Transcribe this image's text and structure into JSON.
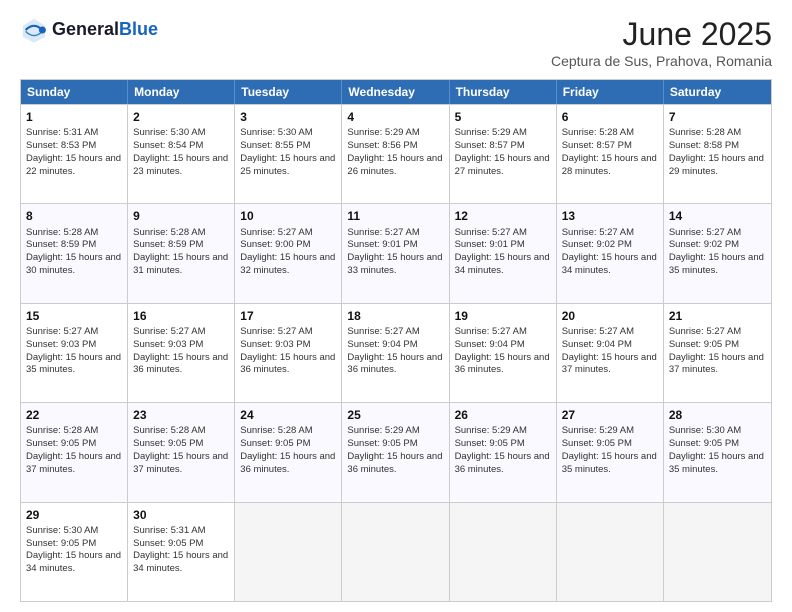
{
  "header": {
    "logo_line1": "General",
    "logo_line2": "Blue",
    "title": "June 2025",
    "subtitle": "Ceptura de Sus, Prahova, Romania"
  },
  "calendar": {
    "days_of_week": [
      "Sunday",
      "Monday",
      "Tuesday",
      "Wednesday",
      "Thursday",
      "Friday",
      "Saturday"
    ],
    "weeks": [
      [
        {
          "empty": true
        },
        {
          "empty": true
        },
        {
          "empty": true
        },
        {
          "empty": true
        },
        {
          "empty": true
        },
        {
          "empty": true
        },
        {
          "empty": true
        }
      ]
    ],
    "rows": [
      {
        "cells": [
          {
            "day": "1",
            "sunrise": "Sunrise: 5:31 AM",
            "sunset": "Sunset: 8:53 PM",
            "daylight": "Daylight: 15 hours and 22 minutes."
          },
          {
            "day": "2",
            "sunrise": "Sunrise: 5:30 AM",
            "sunset": "Sunset: 8:54 PM",
            "daylight": "Daylight: 15 hours and 23 minutes."
          },
          {
            "day": "3",
            "sunrise": "Sunrise: 5:30 AM",
            "sunset": "Sunset: 8:55 PM",
            "daylight": "Daylight: 15 hours and 25 minutes."
          },
          {
            "day": "4",
            "sunrise": "Sunrise: 5:29 AM",
            "sunset": "Sunset: 8:56 PM",
            "daylight": "Daylight: 15 hours and 26 minutes."
          },
          {
            "day": "5",
            "sunrise": "Sunrise: 5:29 AM",
            "sunset": "Sunset: 8:57 PM",
            "daylight": "Daylight: 15 hours and 27 minutes."
          },
          {
            "day": "6",
            "sunrise": "Sunrise: 5:28 AM",
            "sunset": "Sunset: 8:57 PM",
            "daylight": "Daylight: 15 hours and 28 minutes."
          },
          {
            "day": "7",
            "sunrise": "Sunrise: 5:28 AM",
            "sunset": "Sunset: 8:58 PM",
            "daylight": "Daylight: 15 hours and 29 minutes."
          }
        ]
      },
      {
        "cells": [
          {
            "day": "8",
            "sunrise": "Sunrise: 5:28 AM",
            "sunset": "Sunset: 8:59 PM",
            "daylight": "Daylight: 15 hours and 30 minutes."
          },
          {
            "day": "9",
            "sunrise": "Sunrise: 5:28 AM",
            "sunset": "Sunset: 8:59 PM",
            "daylight": "Daylight: 15 hours and 31 minutes."
          },
          {
            "day": "10",
            "sunrise": "Sunrise: 5:27 AM",
            "sunset": "Sunset: 9:00 PM",
            "daylight": "Daylight: 15 hours and 32 minutes."
          },
          {
            "day": "11",
            "sunrise": "Sunrise: 5:27 AM",
            "sunset": "Sunset: 9:01 PM",
            "daylight": "Daylight: 15 hours and 33 minutes."
          },
          {
            "day": "12",
            "sunrise": "Sunrise: 5:27 AM",
            "sunset": "Sunset: 9:01 PM",
            "daylight": "Daylight: 15 hours and 34 minutes."
          },
          {
            "day": "13",
            "sunrise": "Sunrise: 5:27 AM",
            "sunset": "Sunset: 9:02 PM",
            "daylight": "Daylight: 15 hours and 34 minutes."
          },
          {
            "day": "14",
            "sunrise": "Sunrise: 5:27 AM",
            "sunset": "Sunset: 9:02 PM",
            "daylight": "Daylight: 15 hours and 35 minutes."
          }
        ]
      },
      {
        "cells": [
          {
            "day": "15",
            "sunrise": "Sunrise: 5:27 AM",
            "sunset": "Sunset: 9:03 PM",
            "daylight": "Daylight: 15 hours and 35 minutes."
          },
          {
            "day": "16",
            "sunrise": "Sunrise: 5:27 AM",
            "sunset": "Sunset: 9:03 PM",
            "daylight": "Daylight: 15 hours and 36 minutes."
          },
          {
            "day": "17",
            "sunrise": "Sunrise: 5:27 AM",
            "sunset": "Sunset: 9:03 PM",
            "daylight": "Daylight: 15 hours and 36 minutes."
          },
          {
            "day": "18",
            "sunrise": "Sunrise: 5:27 AM",
            "sunset": "Sunset: 9:04 PM",
            "daylight": "Daylight: 15 hours and 36 minutes."
          },
          {
            "day": "19",
            "sunrise": "Sunrise: 5:27 AM",
            "sunset": "Sunset: 9:04 PM",
            "daylight": "Daylight: 15 hours and 36 minutes."
          },
          {
            "day": "20",
            "sunrise": "Sunrise: 5:27 AM",
            "sunset": "Sunset: 9:04 PM",
            "daylight": "Daylight: 15 hours and 37 minutes."
          },
          {
            "day": "21",
            "sunrise": "Sunrise: 5:27 AM",
            "sunset": "Sunset: 9:05 PM",
            "daylight": "Daylight: 15 hours and 37 minutes."
          }
        ]
      },
      {
        "cells": [
          {
            "day": "22",
            "sunrise": "Sunrise: 5:28 AM",
            "sunset": "Sunset: 9:05 PM",
            "daylight": "Daylight: 15 hours and 37 minutes."
          },
          {
            "day": "23",
            "sunrise": "Sunrise: 5:28 AM",
            "sunset": "Sunset: 9:05 PM",
            "daylight": "Daylight: 15 hours and 37 minutes."
          },
          {
            "day": "24",
            "sunrise": "Sunrise: 5:28 AM",
            "sunset": "Sunset: 9:05 PM",
            "daylight": "Daylight: 15 hours and 36 minutes."
          },
          {
            "day": "25",
            "sunrise": "Sunrise: 5:29 AM",
            "sunset": "Sunset: 9:05 PM",
            "daylight": "Daylight: 15 hours and 36 minutes."
          },
          {
            "day": "26",
            "sunrise": "Sunrise: 5:29 AM",
            "sunset": "Sunset: 9:05 PM",
            "daylight": "Daylight: 15 hours and 36 minutes."
          },
          {
            "day": "27",
            "sunrise": "Sunrise: 5:29 AM",
            "sunset": "Sunset: 9:05 PM",
            "daylight": "Daylight: 15 hours and 35 minutes."
          },
          {
            "day": "28",
            "sunrise": "Sunrise: 5:30 AM",
            "sunset": "Sunset: 9:05 PM",
            "daylight": "Daylight: 15 hours and 35 minutes."
          }
        ]
      },
      {
        "cells": [
          {
            "day": "29",
            "sunrise": "Sunrise: 5:30 AM",
            "sunset": "Sunset: 9:05 PM",
            "daylight": "Daylight: 15 hours and 34 minutes."
          },
          {
            "day": "30",
            "sunrise": "Sunrise: 5:31 AM",
            "sunset": "Sunset: 9:05 PM",
            "daylight": "Daylight: 15 hours and 34 minutes."
          },
          {
            "empty": true
          },
          {
            "empty": true
          },
          {
            "empty": true
          },
          {
            "empty": true
          },
          {
            "empty": true
          }
        ]
      }
    ]
  }
}
